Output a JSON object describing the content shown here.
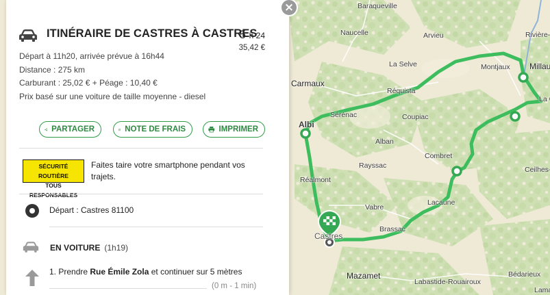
{
  "route": {
    "title": "ITINÉRAIRE DE CASTRES À CASTRES",
    "duration_hours": "5",
    "duration_rest": "h 24",
    "cost": "35,42 €",
    "details": [
      "Départ à 11h20, arrivée prévue à 16h44",
      "Distance : 275 km",
      "Carburant : 25,02 € + Péage : 10,40 €",
      "Prix basé sur une voiture de taille moyenne - diesel"
    ]
  },
  "actions": {
    "share": "PARTAGER",
    "expense": "NOTE DE FRAIS",
    "print": "IMPRIMER"
  },
  "security": {
    "badge_line1": "SÉCURITÉ ROUTIÈRE",
    "badge_line2": "TOUS RESPONSABLES",
    "message": "Faites taire votre smartphone pendant vos trajets."
  },
  "steps": {
    "depart": "Départ : Castres 81100",
    "mode": "EN VOITURE",
    "mode_time": "(1h19)",
    "instruction_prefix": "1. Prendre ",
    "instruction_street": "Rue Émile Zola",
    "instruction_suffix": " et continuer sur 5 mètres",
    "instruction_meta": "(0 m - 1 min)"
  },
  "map": {
    "places": {
      "baraqueville": "Baraqueville",
      "naucelle": "Naucelle",
      "arvieu": "Arvieu",
      "riviere": "Rivière-",
      "millau": "Millau",
      "montjaux": "Montjaux",
      "la_selve": "La Selve",
      "carmaux": "Carmaux",
      "requista": "Réquista",
      "la_cav": "La Ca",
      "serenac": "Sérénac",
      "coupiac": "Coupiac",
      "albi": "Albi",
      "alban": "Alban",
      "combret": "Combret",
      "rayssac": "Rayssac",
      "ceilhes": "Ceilhes-et",
      "realmont": "Réalmont",
      "lacaune": "Lacaune",
      "vabre": "Vabre",
      "brassac": "Brassac",
      "castres": "Castres",
      "mazamet": "Mazamet",
      "labastide": "Labastide-Rouairoux",
      "bedarieux": "Bédarieux",
      "lamalou": "Lamalou"
    },
    "route_color": "#3dbd5e",
    "marker_color": "#35a853"
  }
}
